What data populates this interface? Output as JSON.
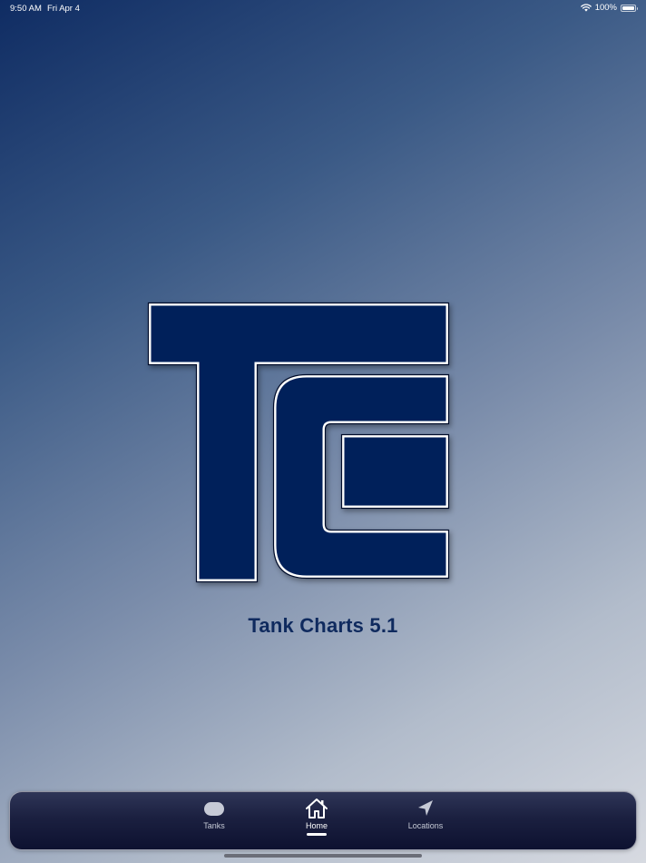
{
  "status_bar": {
    "time": "9:50 AM",
    "date": "Fri Apr 4",
    "battery": "100%",
    "wifi_icon": "wifi-icon",
    "battery_icon": "battery-icon",
    "battery_level": 1.0
  },
  "splash": {
    "logo_icon": "tc-logo",
    "title": "Tank Charts 5.1"
  },
  "colors": {
    "brand_navy": "#00205a",
    "title_navy": "#0f2a5e",
    "tab_bar_dark": "#141a3a"
  },
  "tab_bar": {
    "tabs": [
      {
        "label": "Tanks",
        "icon": "tank-icon",
        "active": false
      },
      {
        "label": "Home",
        "icon": "home-icon",
        "active": true
      },
      {
        "label": "Locations",
        "icon": "location-arrow-icon",
        "active": false
      }
    ]
  }
}
